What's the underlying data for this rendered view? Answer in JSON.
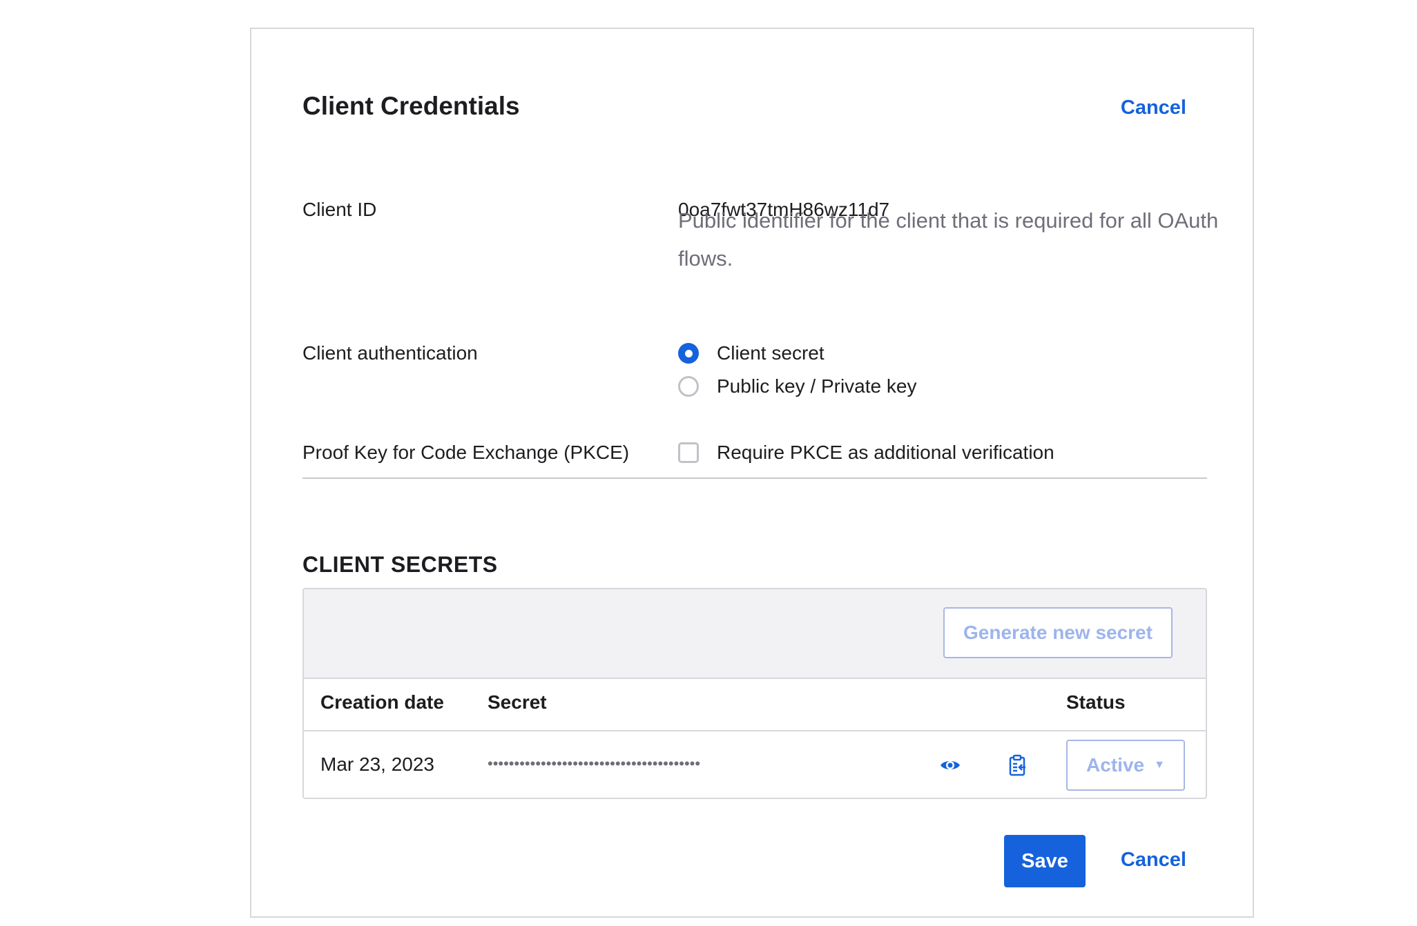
{
  "header": {
    "title": "Client Credentials",
    "cancel_label": "Cancel"
  },
  "client_id": {
    "label": "Client ID",
    "value": "0oa7fwt37tmH86wz11d7",
    "help": "Public identifier for the client that is required for all OAuth flows."
  },
  "client_authentication": {
    "label": "Client authentication",
    "options": [
      {
        "label": "Client secret",
        "checked": true
      },
      {
        "label": "Public key / Private key",
        "checked": false
      }
    ]
  },
  "pkce": {
    "label": "Proof Key for Code Exchange (PKCE)",
    "checkbox_label": "Require PKCE as additional verification",
    "checked": false
  },
  "secrets": {
    "section_title": "CLIENT SECRETS",
    "generate_label": "Generate new secret",
    "columns": [
      "Creation date",
      "Secret",
      "Status"
    ],
    "rows": [
      {
        "creation_date": "Mar 23, 2023",
        "secret_masked": "••••••••••••••••••••••••••••••••••••••••",
        "status": "Active"
      }
    ]
  },
  "footer": {
    "save_label": "Save",
    "cancel_label": "Cancel"
  },
  "colors": {
    "accent": "#1662dd",
    "disabled_text": "#9db4ec",
    "muted_text": "#6e6e78",
    "toolbar_bg": "#f2f2f4"
  },
  "icons": {
    "reveal": "eye-icon",
    "copy": "clipboard-icon",
    "status_caret": "caret-down-icon"
  }
}
